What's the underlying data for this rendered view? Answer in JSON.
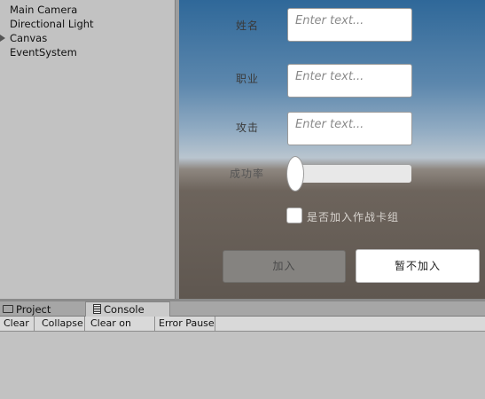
{
  "hierarchy": {
    "items": [
      {
        "label": "Main Camera"
      },
      {
        "label": "Directional Light"
      },
      {
        "label": "Canvas",
        "expandable": true
      },
      {
        "label": "EventSystem"
      }
    ]
  },
  "form": {
    "name_label": "姓名",
    "name_placeholder": "Enter text...",
    "job_label": "职业",
    "job_placeholder": "Enter text...",
    "attack_label": "攻击",
    "attack_placeholder": "Enter text...",
    "rate_label": "成功率",
    "rate_value": 0,
    "join_checkbox_label": "是否加入作战卡组",
    "join_checked": false,
    "join_button": "加入",
    "skip_button": "暂不加入"
  },
  "dock": {
    "tabs": [
      {
        "label": "Project",
        "icon": "folder-icon",
        "active": false
      },
      {
        "label": "Console",
        "icon": "console-icon",
        "active": true
      }
    ],
    "toolbar": [
      "Clear",
      "Collapse",
      "Clear on Play",
      "Error Pause"
    ]
  }
}
